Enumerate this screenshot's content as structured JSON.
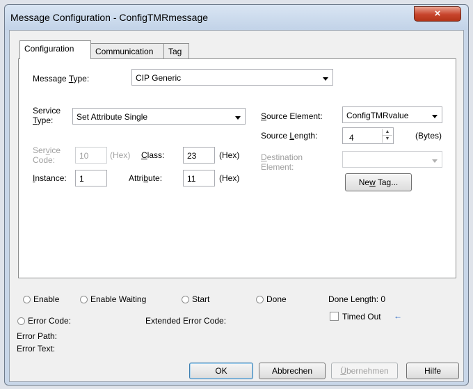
{
  "window": {
    "title": "Message Configuration - ConfigTMRmessage",
    "close_glyph": "×"
  },
  "tabs": [
    {
      "label": "Configuration"
    },
    {
      "label": "Communication"
    },
    {
      "label": "Tag"
    }
  ],
  "config": {
    "message_type": {
      "label_pre": "Message ",
      "label_key": "T",
      "label_post": "ype:",
      "value": "CIP Generic"
    },
    "service_type": {
      "label_line1": "Service",
      "label_key": "T",
      "label_line2": "ype:",
      "value": "Set Attribute Single"
    },
    "service_code": {
      "label_line1": "Ser",
      "label_key": "v",
      "label_line1b": "ice",
      "label_line2": "Code:",
      "value": "10",
      "unit": "(Hex)"
    },
    "class": {
      "label_key": "C",
      "label_post": "lass:",
      "value": "23",
      "unit": "(Hex)"
    },
    "instance": {
      "label_key": "I",
      "label_post": "nstance:",
      "value": "1"
    },
    "attribute": {
      "label_pre": "Attri",
      "label_key": "b",
      "label_post": "ute:",
      "value": "11",
      "unit": "(Hex)"
    },
    "source_element": {
      "label_key": "S",
      "label_post": "ource Element:",
      "value": "ConfigTMRvalue"
    },
    "source_length": {
      "label_pre": "Source ",
      "label_key": "L",
      "label_post": "ength:",
      "value": "4",
      "unit": "(Bytes)"
    },
    "destination_element": {
      "label_key": "D",
      "label_line1": "estination",
      "label_line2": "Element:",
      "value": ""
    },
    "new_tag": {
      "label_pre": "Ne",
      "label_key": "w",
      "label_post": " Tag..."
    }
  },
  "status": {
    "enable": "Enable",
    "enable_waiting": "Enable Waiting",
    "start": "Start",
    "done": "Done",
    "done_length": "Done Length: 0",
    "error_code": "Error Code:",
    "extended_error_code": "Extended Error Code:",
    "timed_out": "Timed Out",
    "timed_out_arrow": "←",
    "error_path": "Error Path:",
    "error_text": "Error Text:"
  },
  "buttons": {
    "ok": "OK",
    "cancel": "Abbrechen",
    "apply_key": "Ü",
    "apply_post": "bernehmen",
    "help": "Hilfe"
  },
  "colors": {
    "close_button": "#c7442c",
    "titlebar": "#c8d6e8",
    "disabled_text": "#a0a0a0"
  }
}
